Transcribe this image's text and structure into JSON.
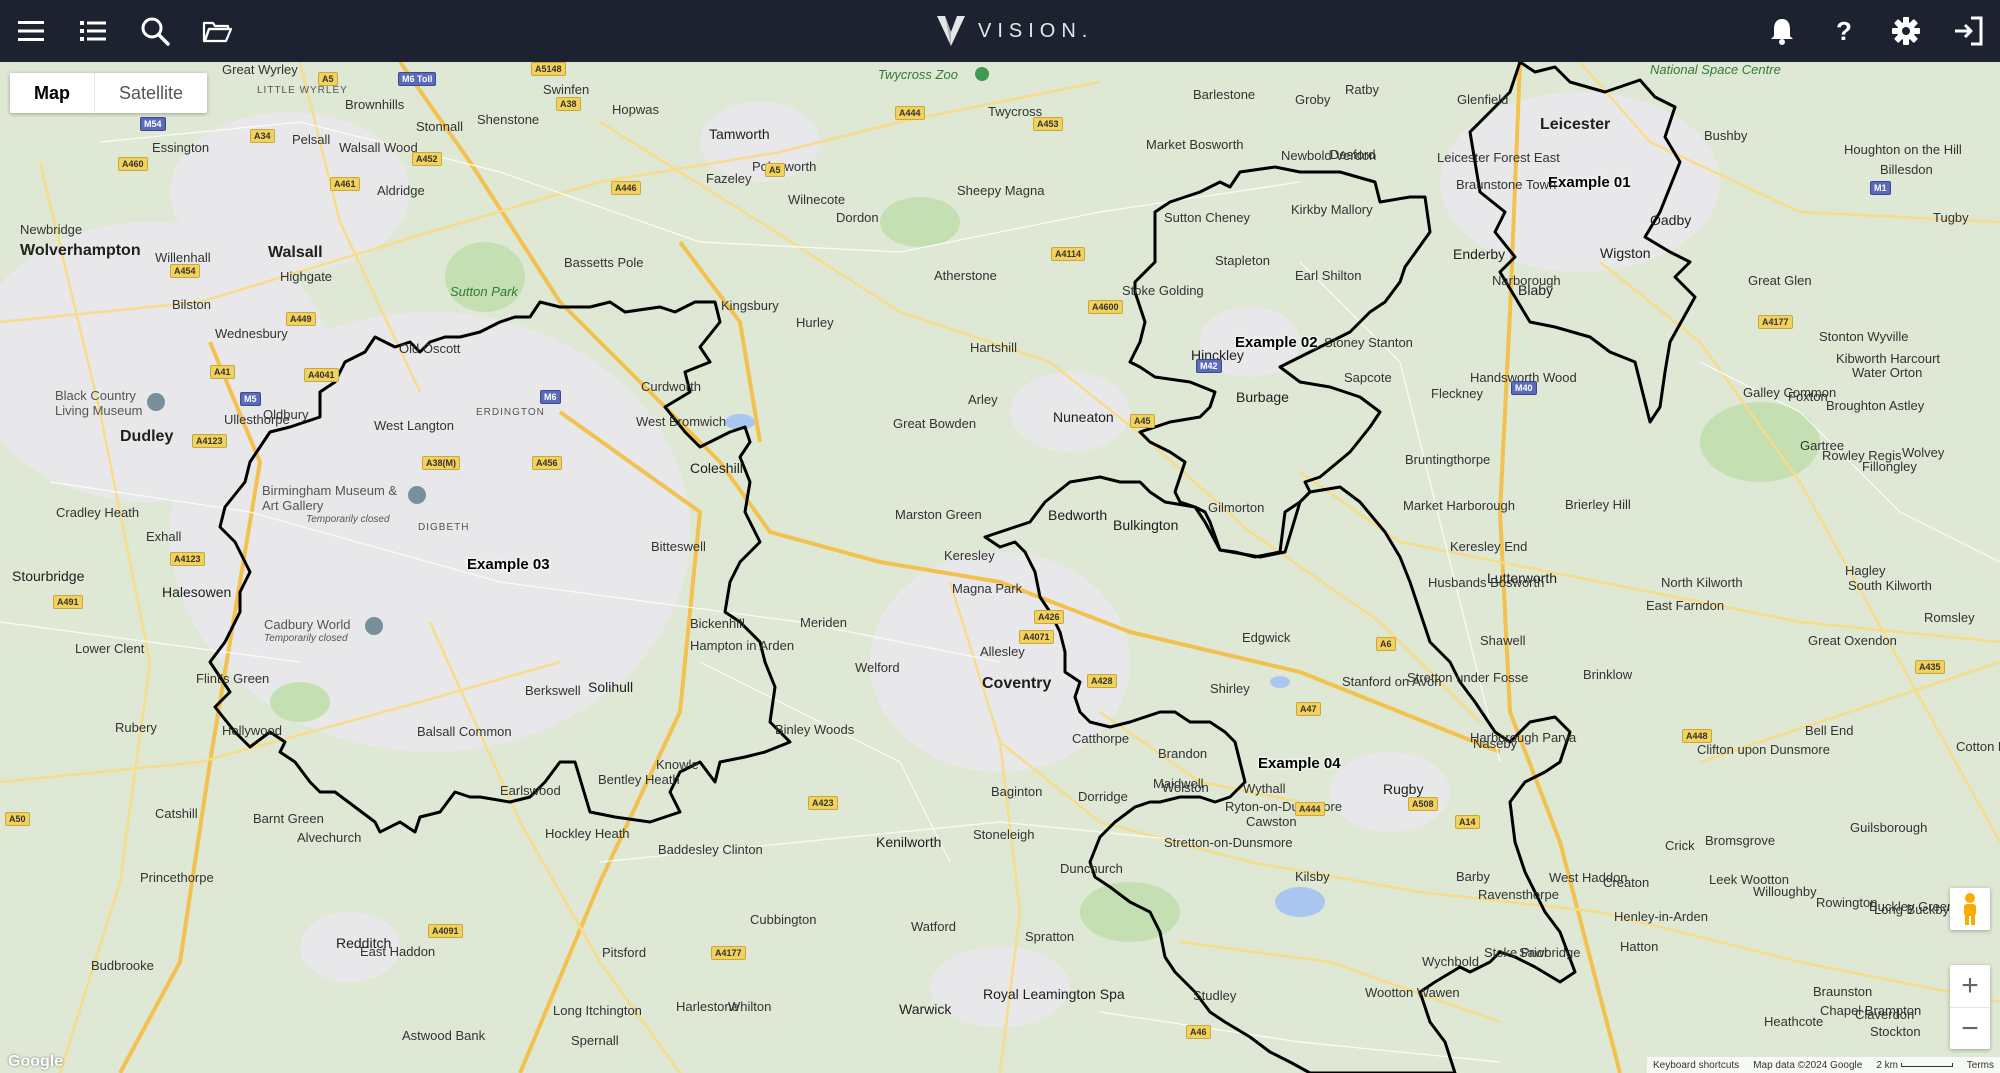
{
  "app": {
    "brand": "VISION.",
    "icons": {
      "menu": "hamburger-menu-icon",
      "list": "list-icon",
      "search": "search-icon",
      "folder": "folder-open-icon",
      "bell": "notification-bell-icon",
      "help": "help-question-icon",
      "settings": "gear-icon",
      "logout": "logout-icon"
    },
    "help_glyph": "?"
  },
  "map_type": {
    "map_label": "Map",
    "satellite_label": "Satellite",
    "selected": "Map"
  },
  "zoom": {
    "in": "+",
    "out": "−"
  },
  "footer": {
    "shortcuts": "Keyboard shortcuts",
    "attribution": "Map data ©2024 Google",
    "scale": "2 km",
    "terms": "Terms",
    "logo": "Google"
  },
  "regions": [
    {
      "id": "01",
      "label": "Example 01"
    },
    {
      "id": "02",
      "label": "Example 02"
    },
    {
      "id": "03",
      "label": "Example 03"
    },
    {
      "id": "04",
      "label": "Example 04"
    }
  ],
  "places": {
    "cities": [
      "Wolverhampton",
      "Walsall",
      "Dudley",
      "Coventry",
      "Leicester"
    ],
    "towns": [
      "Tamworth",
      "Nuneaton",
      "Hinckley",
      "Solihull",
      "Rugby",
      "Kenilworth",
      "Wigston",
      "Lutterworth",
      "Bedworth",
      "Sutton Park",
      "Royal Leamington Spa",
      "Warwick",
      "Halesowen",
      "Stourbridge",
      "Redditch",
      "Coleshill",
      "Burbage",
      "Bulkington",
      "Blaby",
      "Enderby",
      "Oadby"
    ],
    "villages": [
      "Great Wyrley",
      "Brownhills",
      "Swinfen",
      "Hopwas",
      "Twycross",
      "Barlestone",
      "Groby",
      "Ratby",
      "Glenfield",
      "Bushby",
      "Pelsall",
      "Walsall Wood",
      "Stonnall",
      "Shenstone",
      "Essington",
      "Aldridge",
      "Fazeley",
      "Polesworth",
      "Wilnecote",
      "Sheepy Magna",
      "Market Bosworth",
      "Newbold Verdon",
      "Desford",
      "Leicester Forest East",
      "Braunstone Town",
      "Houghton on the Hill",
      "Billesdon",
      "Newbridge",
      "Willenhall",
      "Highgate",
      "Dordon",
      "Sutton Cheney",
      "Kirkby Mallory",
      "Tugby",
      "Bassetts Pole",
      "Kingsbury",
      "Atherstone",
      "Stapleton",
      "Earl Shilton",
      "Narborough",
      "Great Glen",
      "Bilston",
      "Wednesbury",
      "Old Oscott",
      "Hurley",
      "Stoke Golding",
      "Hartshill",
      "Stoney Stanton",
      "Stonton Wyville",
      "Kibworth Harcourt",
      "Curdworth",
      "Sapcote",
      "Fleckney",
      "Handsworth Wood",
      "Water Orton",
      "Galley Common",
      "Broughton Astley",
      "West Langton",
      "West Bromwich",
      "Arley",
      "Bruntingthorpe",
      "Foxton",
      "Oldbury",
      "Gartree",
      "Great Bowden",
      "Rowley Regis",
      "Wolvey",
      "Ullesthorpe",
      "Gilmorton",
      "Market Harborough",
      "Brierley Hill",
      "Fillongley",
      "Cradley Heath",
      "Marston Green",
      "Exhall",
      "Bitteswell",
      "Keresley End",
      "Keresley",
      "Magna Park",
      "Husbands Bosworth",
      "North Kilworth",
      "East Farndon",
      "Hagley",
      "Lower Clent",
      "Bickenhill",
      "Meriden",
      "Hampton in Arden",
      "Allesley",
      "Edgwick",
      "Stretton under Fosse",
      "Shawell",
      "South Kilworth",
      "Great Oxendon",
      "Romsley",
      "Flint's Green",
      "Welford",
      "Berkswell",
      "Shirley",
      "Brinklow",
      "Stanford on Avon",
      "Harborough Parva",
      "Bell End",
      "Rubery",
      "Hollywood",
      "Balsall Common",
      "Binley Woods",
      "Catthorpe",
      "Naseby",
      "Cotton Hackett",
      "Brandon",
      "Clifton upon Dunsmore",
      "Maidwell",
      "Knowle",
      "Wolston",
      "Bentley Heath",
      "Wythall",
      "Baginton",
      "Dorridge",
      "Earlswood",
      "Ryton-on-Dunsmore",
      "Catshill",
      "Barnt Green",
      "Alvechurch",
      "Hockley Heath",
      "Baddesley Clinton",
      "Stoneleigh",
      "Cawston",
      "Stretton-on-Dunsmore",
      "Crick",
      "Guilsborough",
      "West Haddon",
      "Creaton",
      "Bromsgrove",
      "Princethorpe",
      "Dunchurch",
      "Kilsby",
      "Barby",
      "Ravensthorpe",
      "Rowington",
      "Leek Wootton",
      "Cubbington",
      "Watford",
      "Spratton",
      "Stoke Prior",
      "Buckley Green",
      "Hatton",
      "Willoughby",
      "Long Buckby",
      "East Haddon",
      "Pitsford",
      "Wychbold",
      "Henley-in-Arden",
      "Braunston",
      "Chapel Brampton",
      "Claverdon",
      "Budbrooke",
      "Long Itchington",
      "Sawbridge",
      "Whilton",
      "Harlestone",
      "Studley",
      "Wootton Wawen",
      "Heathcote",
      "Stockton",
      "Astwood Bank",
      "Spernall"
    ],
    "small_caps": [
      "LITTLE WYRLEY",
      "ERDINGTON",
      "DIGBETH"
    ],
    "pois": [
      "Twycross Zoo",
      "National Space Centre"
    ],
    "museums": [
      {
        "name": "Black Country Living Museum",
        "note": ""
      },
      {
        "name": "Birmingham Museum & Art Gallery",
        "note": "Temporarily closed"
      },
      {
        "name": "Cadbury World",
        "note": "Temporarily closed"
      }
    ]
  },
  "road_shields": [
    "A5148",
    "M6 Toll",
    "A5",
    "A38",
    "M54",
    "A34",
    "A452",
    "A461",
    "A460",
    "A454",
    "A449",
    "A41",
    "A4041",
    "M5",
    "A4123",
    "A38(M)",
    "M6",
    "A456",
    "A4123",
    "A491",
    "M42",
    "A453",
    "A444",
    "A5",
    "A446",
    "A4114",
    "A4600",
    "A45",
    "A4071",
    "A426",
    "A428",
    "A47",
    "A6",
    "A508",
    "A14",
    "M1",
    "A4177",
    "A435",
    "A448",
    "M40",
    "A423",
    "A4091",
    "A50",
    "A4177",
    "A46",
    "A444"
  ],
  "colors": {
    "topbar": "#1c2230",
    "land": "#dfe8d4",
    "urban": "#e8e8ea",
    "motorway": "#f2c14e",
    "a_road": "#f7dc8a",
    "boundary": "#000000",
    "water": "#a9c6f0",
    "park": "#c4dfb2"
  }
}
